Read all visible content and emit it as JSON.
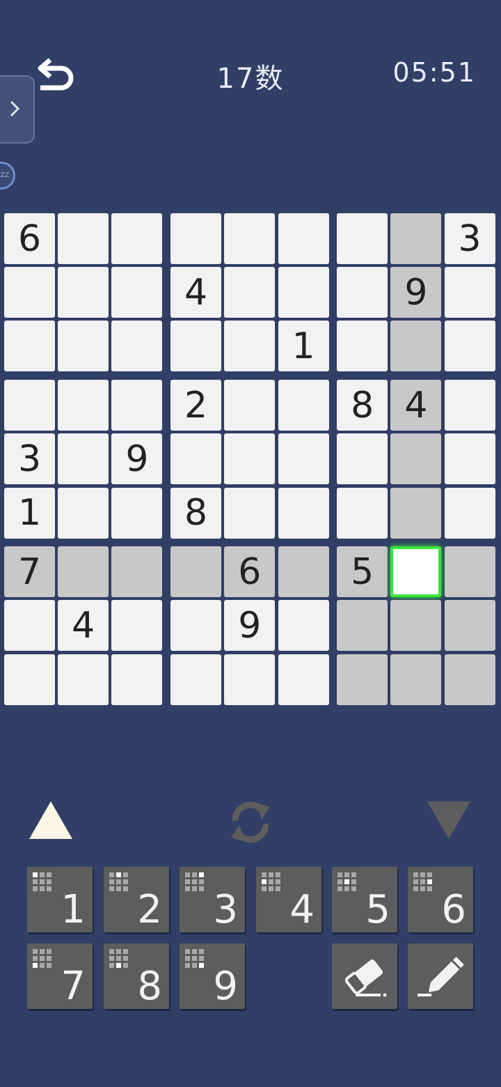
{
  "header": {
    "title": "17数",
    "timer": "05:51"
  },
  "icons": {
    "back": "undo-arrow-icon",
    "side_tab": "chevron-right-icon",
    "badge": "zz-badge-icon",
    "up": "triangle-up-icon",
    "cycle": "refresh-cycle-icon",
    "down": "triangle-down-icon",
    "erase": "eraser-icon",
    "pencil": "pencil-icon"
  },
  "badge_text": "ZZ",
  "colors": {
    "background": "#313e65",
    "cell": "#f2f2f2",
    "highlight": "#c8c8c8",
    "selected_border": "#39e639",
    "key": "#5d5d5d"
  },
  "board": {
    "selected": [
      6,
      7
    ],
    "rows": [
      [
        "6",
        "",
        "",
        "",
        "",
        "",
        "",
        "",
        "3"
      ],
      [
        "",
        "",
        "",
        "4",
        "",
        "",
        "",
        "9",
        ""
      ],
      [
        "",
        "",
        "",
        "",
        "",
        "1",
        "",
        "",
        ""
      ],
      [
        "",
        "",
        "",
        "2",
        "",
        "",
        "8",
        "4",
        ""
      ],
      [
        "3",
        "",
        "9",
        "",
        "",
        "",
        "",
        "",
        ""
      ],
      [
        "1",
        "",
        "",
        "8",
        "",
        "",
        "",
        "",
        ""
      ],
      [
        "7",
        "",
        "",
        "",
        "6",
        "",
        "5",
        "",
        ""
      ],
      [
        "",
        "4",
        "",
        "",
        "9",
        "",
        "",
        "",
        ""
      ],
      [
        "",
        "",
        "",
        "",
        "",
        "",
        "",
        "",
        ""
      ]
    ]
  },
  "keypad": {
    "numbers": [
      "1",
      "2",
      "3",
      "4",
      "5",
      "6",
      "7",
      "8",
      "9"
    ]
  }
}
